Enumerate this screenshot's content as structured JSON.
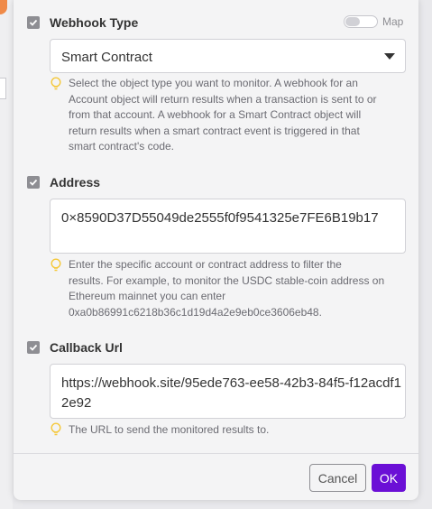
{
  "webhook_type": {
    "label": "Webhook Type",
    "map_label": "Map",
    "selected": "Smart Contract",
    "hint": [
      "Select the object type you want to monitor. A webhook for an",
      "Account object will return results when a transaction is sent to or",
      "from that account. A webhook for a Smart Contract object will",
      "return results when a smart contract event is triggered in that",
      "smart contract's code."
    ]
  },
  "address": {
    "label": "Address",
    "value": "0×8590D37D55049de2555f0f9541325e7FE6B19b17",
    "hint": [
      "Enter the specific account or contract address to filter the",
      "results. For example, to monitor the USDC stable-coin address on",
      "Ethereum mainnet you can enter",
      "0xa0b86991c6218b36c1d19d4a2e9eb0ce3606eb48."
    ]
  },
  "callback_url": {
    "label": "Callback Url",
    "value": "https://webhook.site/95ede763-ee58-42b3-84f5-f12acdf12e92",
    "hint": [
      "The URL to send the monitored results to."
    ]
  },
  "footer": {
    "cancel_label": "Cancel",
    "ok_label": "OK"
  },
  "colors": {
    "accent": "#6b0fd6",
    "hint_icon": "#f5c83a",
    "checkbox": "#8e8e93"
  },
  "icons": [
    "checkbox-checked-icon",
    "lightbulb-icon",
    "chevron-down-icon"
  ]
}
